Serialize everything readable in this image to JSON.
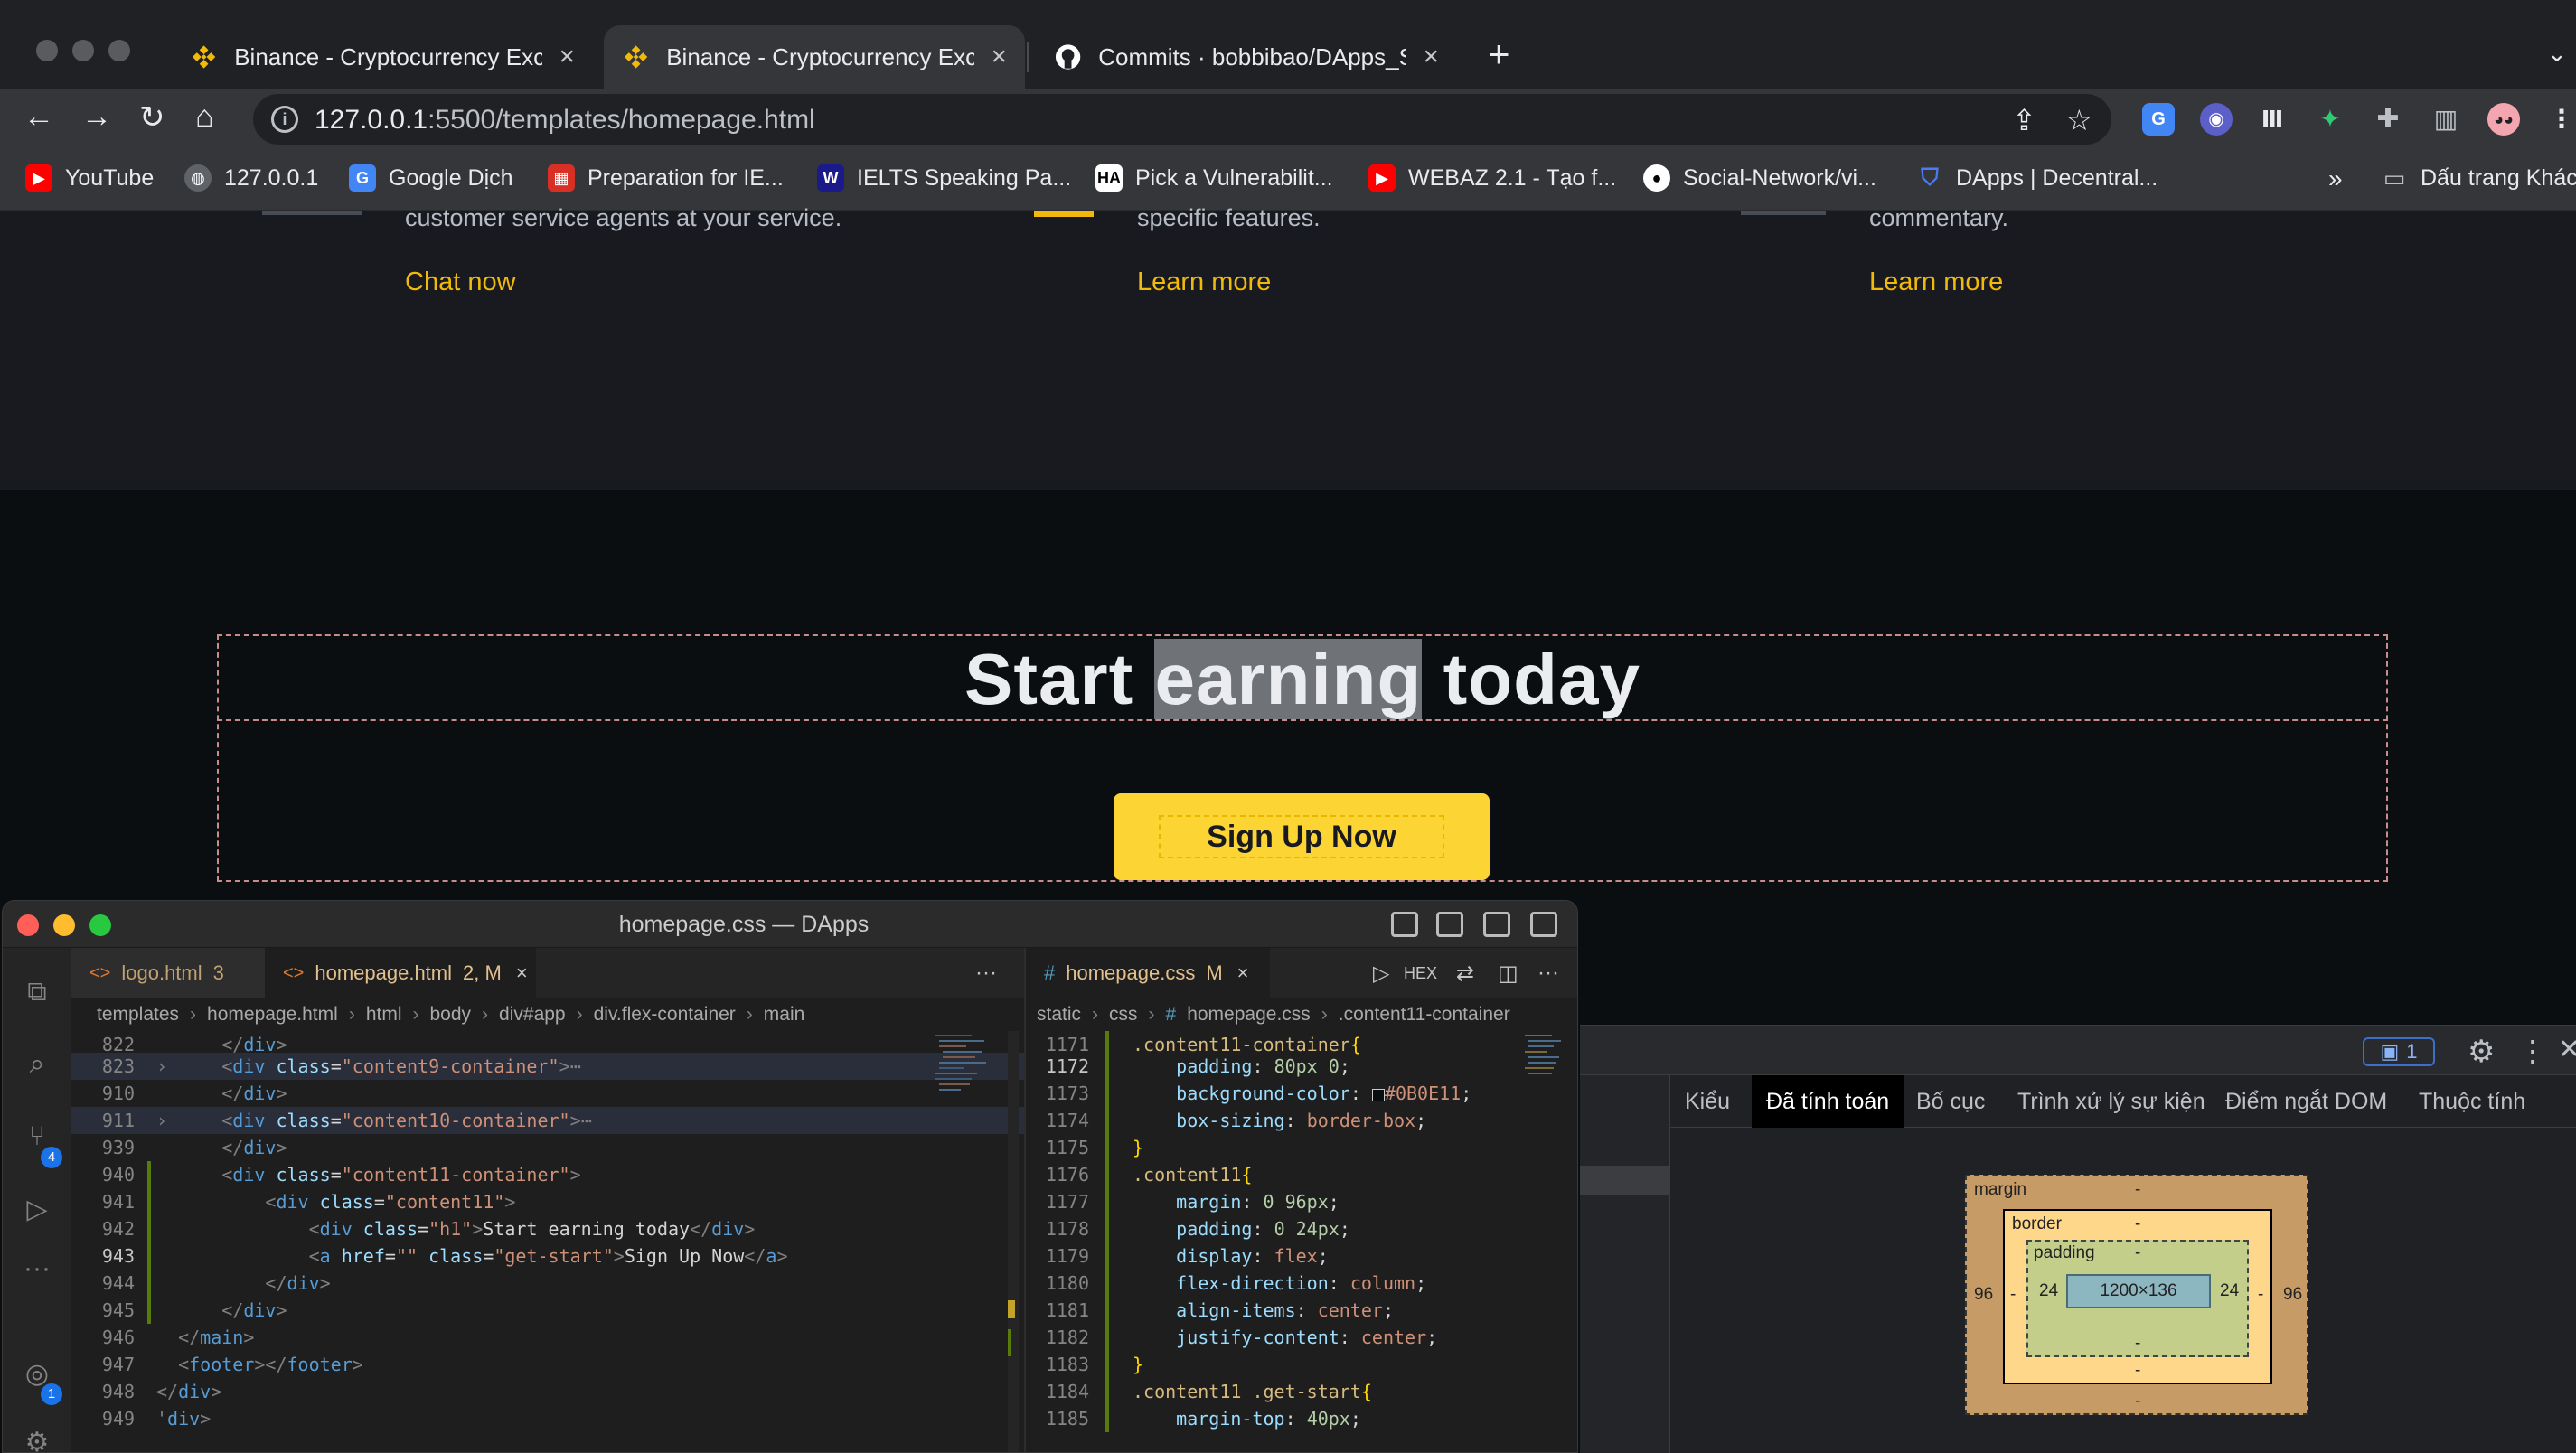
{
  "browser": {
    "tabs": [
      {
        "title": "Binance - Cryptocurrency Exch"
      },
      {
        "title": "Binance - Cryptocurrency Exch"
      },
      {
        "title": "Commits · bobbibao/DApps_Su"
      }
    ],
    "url_host": "127.0.0.1",
    "url_rest": ":5500/templates/homepage.html",
    "bookmarks": [
      {
        "label": "YouTube"
      },
      {
        "label": "127.0.0.1"
      },
      {
        "label": "Google Dịch"
      },
      {
        "label": "Preparation for IE..."
      },
      {
        "label": "IELTS Speaking Pa..."
      },
      {
        "label": "Pick a Vulnerabilit..."
      },
      {
        "label": "WEBAZ 2.1 - Tạo f..."
      },
      {
        "label": "Social-Network/vi..."
      },
      {
        "label": "DApps | Decentral..."
      }
    ],
    "bookmarks_more": "»",
    "bookmarks_folder": "Dấu trang Khác"
  },
  "page": {
    "features": [
      {
        "text": "customer service agents at your service.",
        "link": "Chat now"
      },
      {
        "text": "specific features.",
        "link": "Learn more"
      },
      {
        "text": "commentary.",
        "link": "Learn more"
      }
    ],
    "hero_before": "Start ",
    "hero_highlight": "earning",
    "hero_after": " today",
    "signup": "Sign Up Now"
  },
  "devtools": {
    "issues_count": "1",
    "tabs": [
      "Kiểu",
      "Đã tính toán",
      "Bố cục",
      "Trình xử lý sự kiện",
      "Điểm ngắt DOM",
      "Thuộc tính"
    ],
    "box": {
      "margin_label": "margin",
      "border_label": "border",
      "padding_label": "padding",
      "margin_left": "96",
      "margin_right": "96",
      "margin_top": "-",
      "margin_bottom": "-",
      "border_top": "-",
      "border_bottom": "-",
      "border_left": "-",
      "border_right": "-",
      "padding_top": "-",
      "padding_bottom": "-",
      "padding_left": "24",
      "padding_right": "24",
      "content": "1200×136"
    }
  },
  "vscode": {
    "title": "homepage.css — DApps",
    "scm_badge": "4",
    "account_badge": "1",
    "left_tabs": [
      {
        "name": "logo.html",
        "badge": "3"
      },
      {
        "name": "homepage.html",
        "badge": "2, M"
      }
    ],
    "left_breadcrumb": [
      "templates",
      "homepage.html",
      "html",
      "body",
      "div#app",
      "div.flex-container",
      "main"
    ],
    "right_tab": {
      "name": "homepage.css",
      "badge": "M"
    },
    "right_breadcrumb": [
      "static",
      "css",
      "homepage.css",
      ".content11-container"
    ],
    "hex_label": "HEX"
  }
}
